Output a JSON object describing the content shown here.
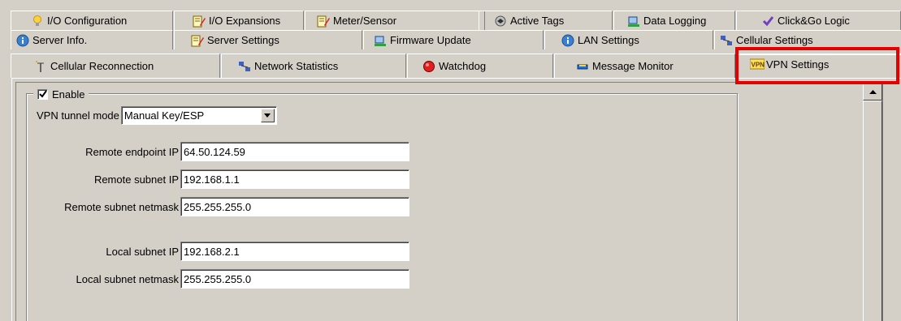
{
  "tabs": {
    "row1": [
      {
        "label": "I/O Configuration",
        "icon": "lightbulb-icon"
      },
      {
        "label": "I/O Expansions",
        "icon": "edit-sheet-icon"
      },
      {
        "label": "Meter/Sensor",
        "icon": "edit-sheet-icon"
      },
      {
        "label": "Active Tags",
        "icon": "tags-icon"
      },
      {
        "label": "Data Logging",
        "icon": "logging-icon"
      },
      {
        "label": "Click&Go Logic",
        "icon": "logic-icon"
      }
    ],
    "row2": [
      {
        "label": "Server Info.",
        "icon": "info-icon"
      },
      {
        "label": "Server Settings",
        "icon": "edit-sheet-icon"
      },
      {
        "label": "Firmware Update",
        "icon": "firmware-icon"
      },
      {
        "label": "LAN Settings",
        "icon": "info-icon"
      },
      {
        "label": "Cellular Settings",
        "icon": "network-icon"
      }
    ],
    "row3": [
      {
        "label": "Cellular Reconnection",
        "icon": "antenna-icon"
      },
      {
        "label": "Network Statistics",
        "icon": "network-icon"
      },
      {
        "label": "Watchdog",
        "icon": "watchdog-icon"
      },
      {
        "label": "Message Monitor",
        "icon": "message-icon"
      },
      {
        "label": "VPN Settings",
        "icon": "vpn-icon",
        "active": true
      }
    ]
  },
  "vpn": {
    "enable_label": "Enable",
    "enable_checked": true,
    "tunnel_mode_label": "VPN tunnel mode",
    "tunnel_mode_value": "Manual Key/ESP",
    "remote_endpoint_label": "Remote endpoint IP",
    "remote_endpoint_value": "64.50.124.59",
    "remote_subnet_label": "Remote subnet IP",
    "remote_subnet_value": "192.168.1.1",
    "remote_netmask_label": "Remote subnet netmask",
    "remote_netmask_value": "255.255.255.0",
    "local_subnet_label": "Local subnet IP",
    "local_subnet_value": "192.168.2.1",
    "local_netmask_label": "Local subnet netmask",
    "local_netmask_value": "255.255.255.0"
  },
  "colors": {
    "highlight": "#e60000",
    "face": "#d4d0c8"
  }
}
